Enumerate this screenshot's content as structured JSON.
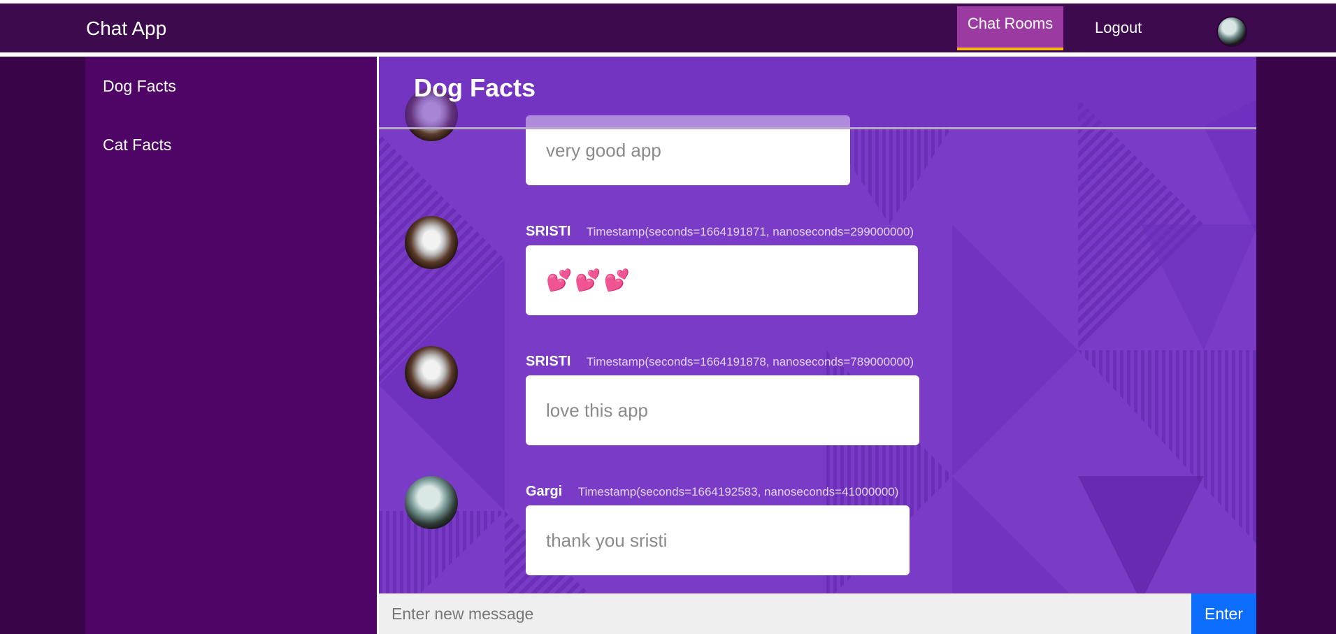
{
  "navbar": {
    "brand": "Chat App",
    "links": [
      "Chat Rooms",
      "Logout"
    ],
    "active_link": "Chat Rooms"
  },
  "sidebar": {
    "rooms": [
      "Dog Facts",
      "Cat Facts"
    ]
  },
  "chat": {
    "room_title": "Dog Facts",
    "messages": [
      {
        "name": "",
        "timestamp": "",
        "text": "very good app",
        "avatar": "cat-avatar"
      },
      {
        "name": "SRISTI",
        "timestamp": "Timestamp(seconds=1664191871, nanoseconds=299000000)",
        "text": "💕💕💕",
        "avatar": "cat-avatar"
      },
      {
        "name": "SRISTI",
        "timestamp": "Timestamp(seconds=1664191878, nanoseconds=789000000)",
        "text": "love this app",
        "avatar": "cat-avatar"
      },
      {
        "name": "Gargi",
        "timestamp": "Timestamp(seconds=1664192583, nanoseconds=41000000)",
        "text": "thank you sristi",
        "avatar": "user-avatar"
      }
    ]
  },
  "composer": {
    "placeholder": "Enter new message",
    "button_label": "Enter"
  },
  "colors": {
    "navbar_bg": "#3c0a4d",
    "sidebar_bg": "#4e0566",
    "chat_bg": "#7a3cc7",
    "active_tab": "#9b3aa0",
    "active_underline": "#f5b61a",
    "button": "#0d6efd"
  }
}
